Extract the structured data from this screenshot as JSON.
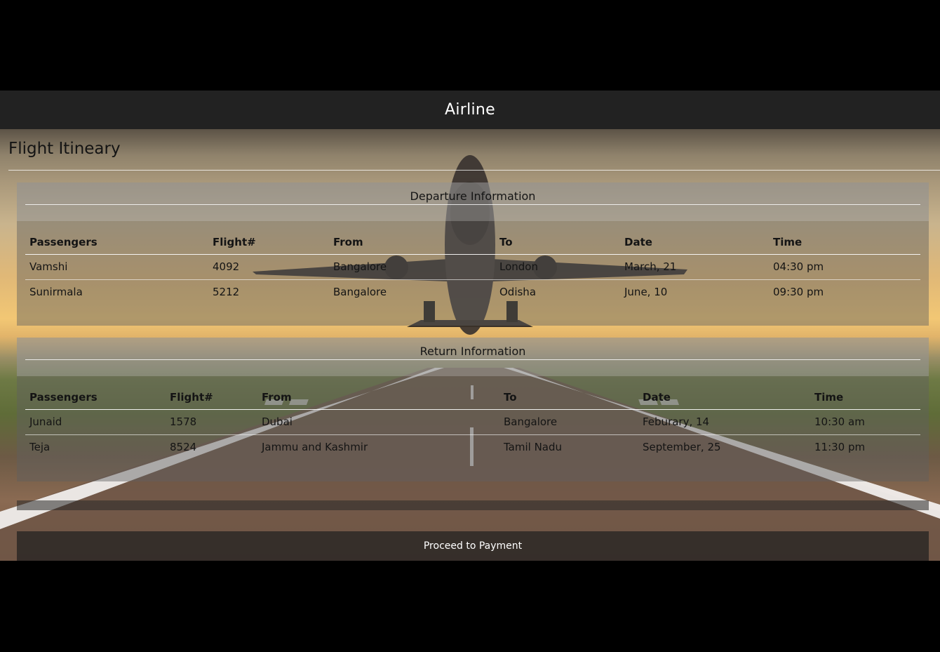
{
  "header": {
    "title": "Airline"
  },
  "page": {
    "title": "Flight Itineary"
  },
  "departure": {
    "heading": "Departure Information",
    "columns": [
      "Passengers",
      "Flight#",
      "From",
      "To",
      "Date",
      "Time"
    ],
    "rows": [
      [
        "Vamshi",
        "4092",
        "Bangalore",
        "London",
        "March, 21",
        "04:30 pm"
      ],
      [
        "Sunirmala",
        "5212",
        "Bangalore",
        "Odisha",
        "June, 10",
        "09:30 pm"
      ]
    ]
  },
  "return": {
    "heading": "Return Information",
    "columns": [
      "Passengers",
      "Flight#",
      "From",
      "To",
      "Date",
      "Time"
    ],
    "rows": [
      [
        "Junaid",
        "1578",
        "Dubai",
        "Bangalore",
        "Feburary, 14",
        "10:30 am"
      ],
      [
        "Teja",
        "8524",
        "Jammu and Kashmir",
        "Tamil Nadu",
        "September, 25",
        "11:30 pm"
      ]
    ]
  },
  "actions": {
    "proceed_label": "Proceed to Payment"
  },
  "colors": {
    "header_bg": "#222222",
    "page_bg": "#000000"
  }
}
